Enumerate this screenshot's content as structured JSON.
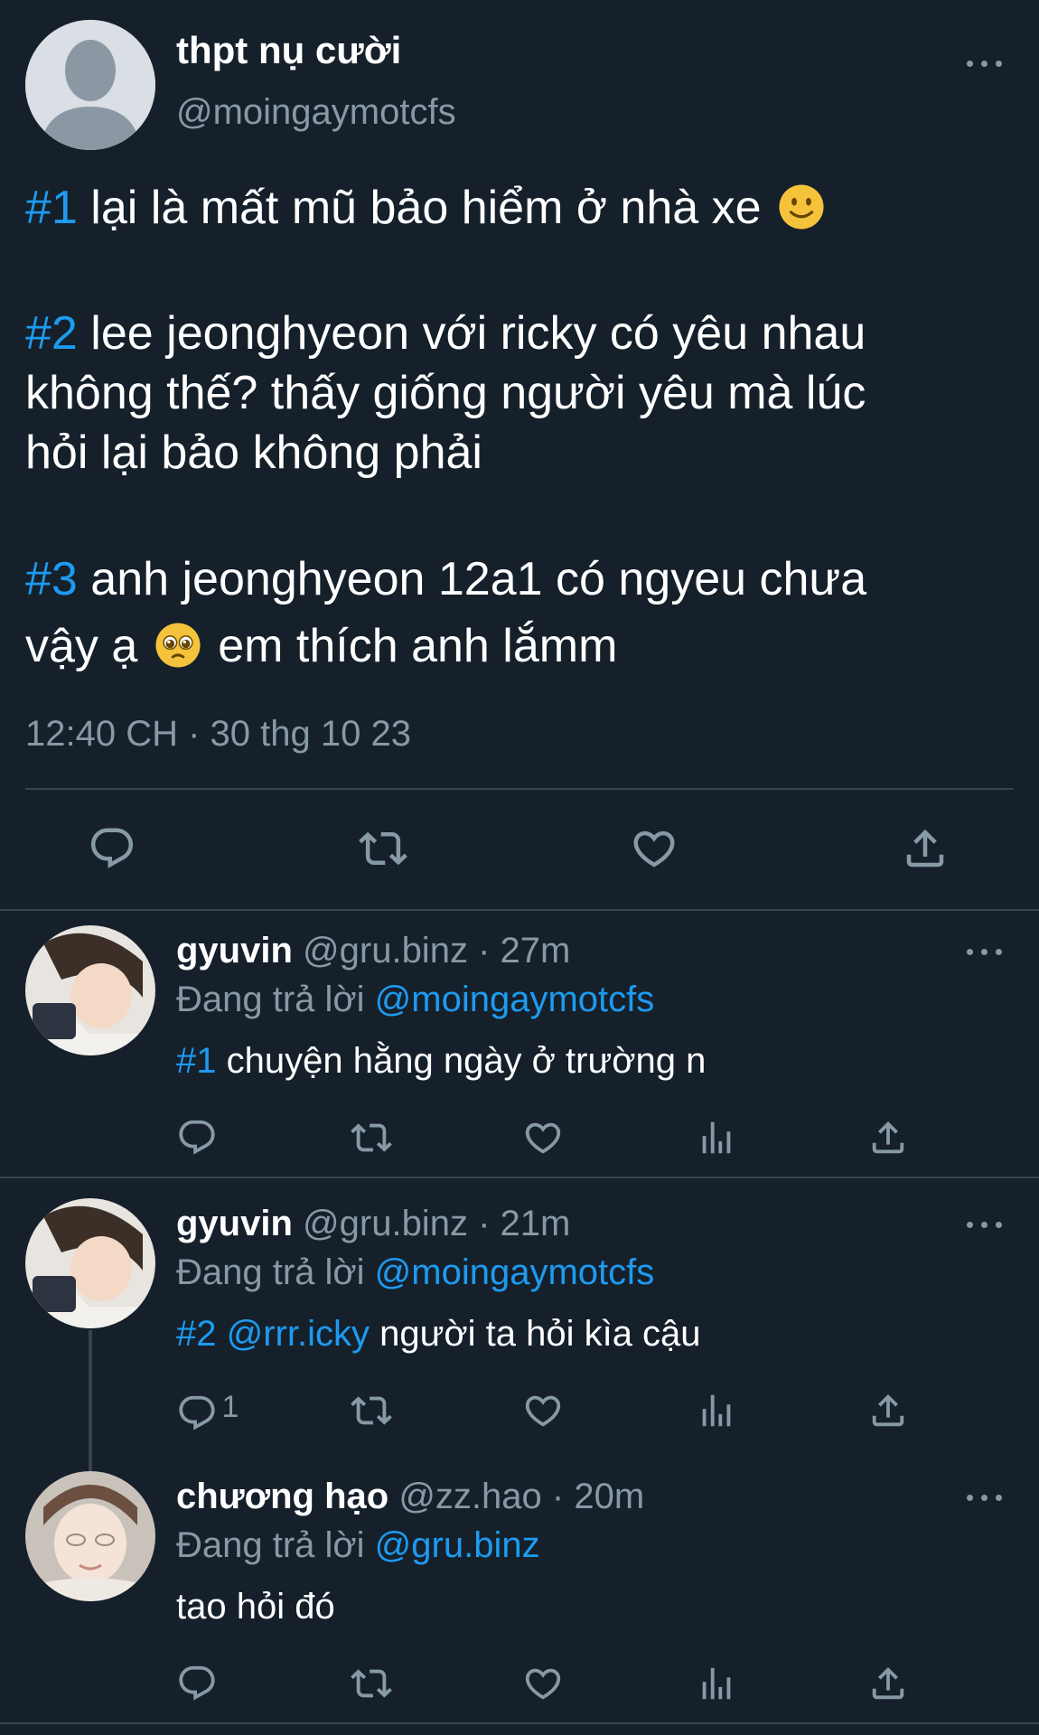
{
  "main_tweet": {
    "display_name": "thpt nụ cười",
    "handle": "@moingaymotcfs",
    "confessions": [
      {
        "tag": "#1",
        "lines": [
          "lại là mất mũ bảo hiểm ở nhà xe"
        ],
        "emoji": "slightly-smiling-face"
      },
      {
        "tag": "#2",
        "lines": [
          "lee jeonghyeon với ricky có yêu nhau",
          "không thế? thấy giống người yêu mà lúc",
          "hỏi lại bảo không phải"
        ]
      },
      {
        "tag": "#3",
        "lines": [
          "anh jeonghyeon 12a1 có ngyeu chưa",
          "vậy ạ",
          "em thích anh lắmm"
        ],
        "emoji": "pleading-face"
      }
    ],
    "timestamp": "12:40 CH · 30 thg 10 23",
    "actions": [
      "reply-icon",
      "retweet-icon",
      "heart-icon",
      "share-icon"
    ]
  },
  "replies": [
    {
      "name": "gyuvin",
      "handle": "@gru.binz",
      "time": "· 27m",
      "replying_label": "Đang trả lời",
      "replying_to": "@moingaymotcfs",
      "tag": "#1",
      "mention": "",
      "text": "chuyện hằng ngày ở trường n",
      "reply_count": ""
    },
    {
      "name": "gyuvin",
      "handle": "@gru.binz",
      "time": "· 21m",
      "replying_label": "Đang trả lời",
      "replying_to": "@moingaymotcfs",
      "tag": "#2",
      "mention": "@rrr.icky",
      "text": "người ta hỏi kìa cậu",
      "reply_count": "1"
    },
    {
      "name": "chương hạo",
      "handle": "@zz.hao",
      "time": "· 20m",
      "replying_label": "Đang trả lời",
      "replying_to": "@gru.binz",
      "tag": "",
      "mention": "",
      "text": "tao hỏi đó",
      "reply_count": ""
    }
  ],
  "colors": {
    "background": "#15202b",
    "accent": "#1d9bf0",
    "muted": "#8899a6",
    "divider": "#38444d"
  }
}
